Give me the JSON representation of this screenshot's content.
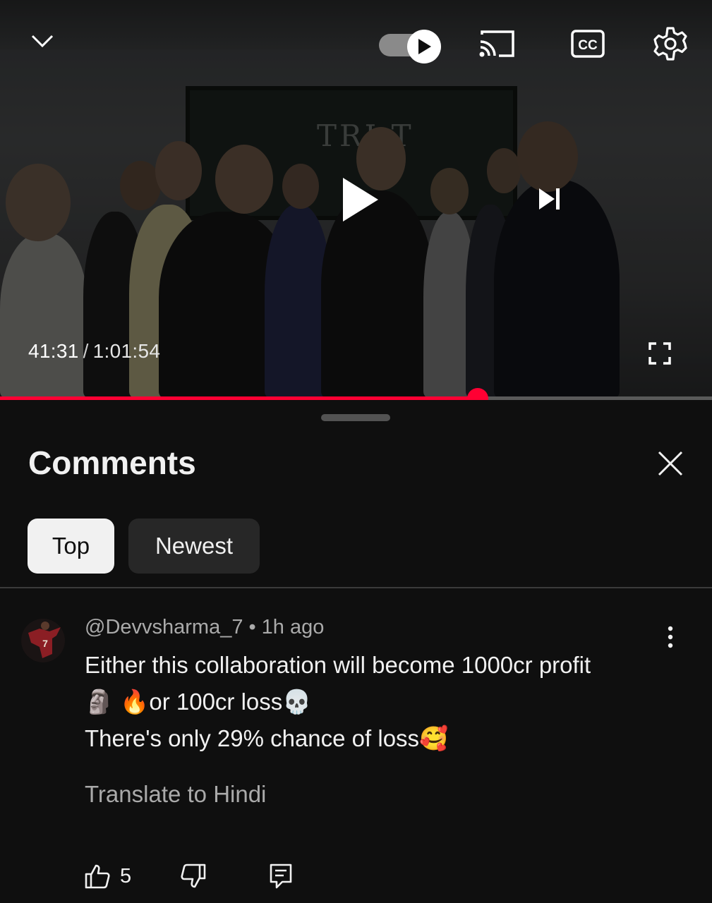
{
  "player": {
    "current_time": "41:31",
    "separator": "/",
    "duration": "1:01:54",
    "progress_fraction": 0.671,
    "autoplay_on": true,
    "board_text": "TRI T"
  },
  "comments_panel": {
    "title": "Comments",
    "sort_chips": [
      {
        "label": "Top",
        "selected": true
      },
      {
        "label": "Newest",
        "selected": false
      }
    ]
  },
  "comment": {
    "author": "@Devvsharma_7",
    "bullet": "•",
    "time_ago": "1h ago",
    "text": "Either this collaboration will become 1000cr profit\n🗿 🔥or 100cr loss💀\nThere's only 29% chance of loss🥰",
    "translate_label": "Translate to Hindi",
    "likes": "5"
  },
  "colors": {
    "accent": "#ff0033",
    "background": "#0f0f0f",
    "chip_selected": "#f1f1f1",
    "chip_unselected": "#272727",
    "secondary_text": "#aaaaaa"
  }
}
